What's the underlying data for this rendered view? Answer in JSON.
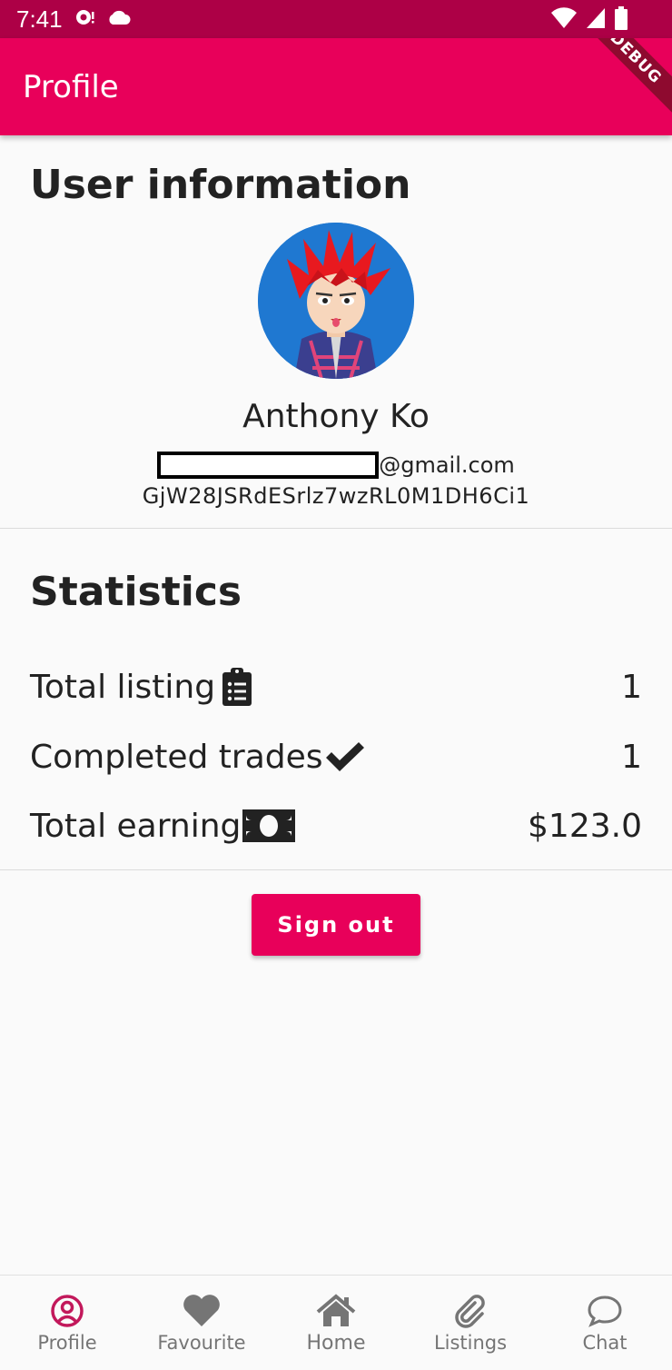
{
  "status_bar": {
    "time": "7:41"
  },
  "app_bar": {
    "title": "Profile",
    "debug_label": "DEBUG"
  },
  "user_info": {
    "section_title": "User information",
    "name": "Anthony Ko",
    "email_suffix": "@gmail.com",
    "user_id": "GjW28JSRdESrlz7wzRL0M1DH6Ci1"
  },
  "statistics": {
    "section_title": "Statistics",
    "rows": [
      {
        "label": "Total listing",
        "value": "1",
        "icon": "clipboard-list-icon"
      },
      {
        "label": "Completed trades",
        "value": "1",
        "icon": "check-icon"
      },
      {
        "label": "Total earning",
        "value": "$123.0",
        "icon": "money-bill-icon"
      }
    ]
  },
  "sign_out": {
    "label": "Sign out"
  },
  "bottom_nav": {
    "items": [
      {
        "label": "Profile",
        "icon": "user-circle-icon",
        "active": true
      },
      {
        "label": "Favourite",
        "icon": "heart-icon",
        "active": false
      },
      {
        "label": "Home",
        "icon": "home-icon",
        "active": false
      },
      {
        "label": "Listings",
        "icon": "paperclip-icon",
        "active": false
      },
      {
        "label": "Chat",
        "icon": "chat-bubble-icon",
        "active": false
      }
    ]
  },
  "colors": {
    "primary": "#e8005a",
    "status_bar": "#ad0046",
    "active_nav_icon": "#c2185b",
    "inactive_nav": "#757575"
  }
}
